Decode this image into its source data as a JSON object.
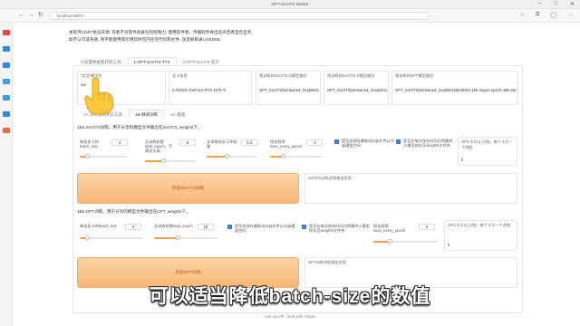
{
  "window": {
    "title": "GPT-SoVITS WebUI"
  },
  "browser": {
    "url": "localhost:9874"
  },
  "intro": {
    "line1": "本软件以MIT协议开源, 作者不对软件具备任何控制力, 使用软件者、传播软件导出的声音者自负全责.",
    "line2": "如不认可该条款, 则不能使用或引用软件包内任何代码和文件. 详见根目录LICENSE."
  },
  "main_tabs": [
    "0-前置数据集获取工具",
    "1-GPT-SoVITS-TTS",
    "2-GPT-SoVITS-变声"
  ],
  "top_fields": [
    {
      "label": "*实验/模型名",
      "value": "xxx"
    },
    {
      "label": "显卡信息",
      "value": "0 NVIDIA GeForce RTX 4070 Ti"
    },
    {
      "label": "预训练的SoVITS-G模型路径",
      "value": "GPT_SoVITS/pretrained_models/s2G488k.pth"
    },
    {
      "label": "预训练的SoVITS-D模型路径",
      "value": "GPT_SoVITS/pretrained_models/s2D488k.pth"
    },
    {
      "label": "预训练的GPT模型路径",
      "value": "GPT_SoVITS/pretrained_models/s1bert25hz-2kh-longer-epoch=68e-step=50232.ckpt"
    }
  ],
  "sub_tabs": [
    "1A-训练集格式化工具",
    "1B-微调训练",
    "1C-推理"
  ],
  "sovits": {
    "title": "1Ba-SoVITS训练。用于分享的模型文件输出在SoVITS_weights下。",
    "params": [
      {
        "label": "每张显卡的batch_size",
        "value": "4"
      },
      {
        "label": "总训练轮数total_epoch，不建议太高",
        "value": "8"
      },
      {
        "label": "文本模块学习率权重",
        "value": "0.4"
      },
      {
        "label": "保存频率save_every_epoch",
        "value": "4"
      }
    ],
    "check1": "是否仅保存最新的ckpt文件以节省硬盘空间",
    "check2": "是否在每次保存时间点将最终小模型保存至weights文件夹",
    "gpu_label": "GPU卡号以-分割，每个卡号一个进程",
    "gpu_value": "0",
    "button": "开启SoVITS训练",
    "info_label": "SoVITS训练进程输出信息"
  },
  "gpt": {
    "title": "1Bb-GPT训练。用于分享的模型文件输出在GPT_weights下。",
    "params": [
      {
        "label": "每张显卡的batch_size",
        "value": "4"
      },
      {
        "label": "总训练轮数total_epoch",
        "value": "15"
      }
    ],
    "check1": "是否仅保存最新的ckpt文件以节省硬盘空间",
    "check2": "是否在每次保存时间点将最终小模型保存至weights文件夹",
    "save_label": "保存频率save_every_epoch",
    "save_value": "5",
    "gpu_label": "GPU卡号以-分割，每个卡号一个进程",
    "gpu_value": "0",
    "button": "开启GPT训练",
    "info_label": "GPT训练进程输出信息"
  },
  "caption": "可以适当降低batch-size的数值",
  "footer": "Use via API  ·  Built with Gradio",
  "colors": {
    "accent": "#f5a040",
    "button_bg": "#f8c28c",
    "checkbox": "#2f6fe0"
  }
}
